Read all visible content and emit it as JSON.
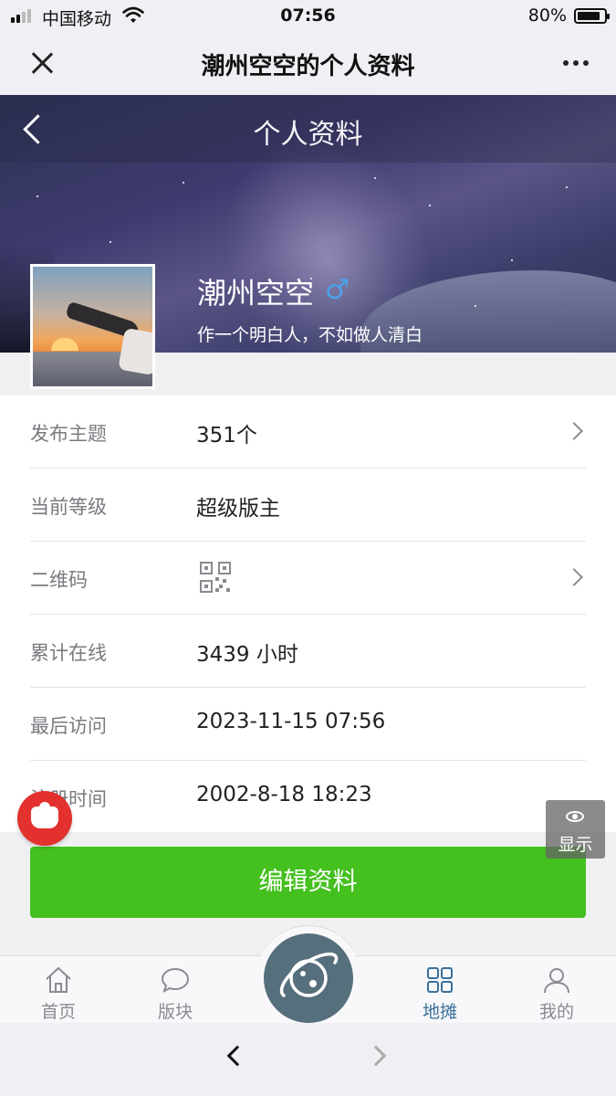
{
  "status_bar": {
    "carrier": "中国移动",
    "time": "07:56",
    "battery": "80%"
  },
  "wechat_nav": {
    "title": "潮州空空的个人资料"
  },
  "header": {
    "title": "个人资料"
  },
  "profile": {
    "name": "潮州空空",
    "gender_symbol": "♂",
    "gender_color": "#4aa3e8",
    "signature": "作一个明白人，不如做人清白"
  },
  "info_rows": [
    {
      "label": "发布主题",
      "value": "351个",
      "chevron": true
    },
    {
      "label": "当前等级",
      "value": "超级版主",
      "chevron": false
    },
    {
      "label": "二维码",
      "value": "",
      "icon": "qr-code-icon",
      "chevron": true
    },
    {
      "label": "累计在线",
      "value": "3439 小时",
      "chevron": false
    },
    {
      "label": "最后访问",
      "value": "2023-11-15 07:56",
      "chevron": false
    },
    {
      "label": "注册时间",
      "value": "2002-8-18 18:23",
      "chevron": false
    }
  ],
  "edit_button": {
    "label": "编辑资料",
    "color": "#44c01f"
  },
  "float_show": {
    "label": "显示"
  },
  "tabbar": {
    "items": [
      {
        "label": "首页",
        "icon": "home-icon"
      },
      {
        "label": "版块",
        "icon": "chat-bubble-icon"
      },
      {
        "label": "",
        "icon": "planet-icon"
      },
      {
        "label": "地摊",
        "icon": "grid-icon",
        "active": true
      },
      {
        "label": "我的",
        "icon": "user-icon"
      }
    ],
    "active_color": "#3a6f9a"
  }
}
